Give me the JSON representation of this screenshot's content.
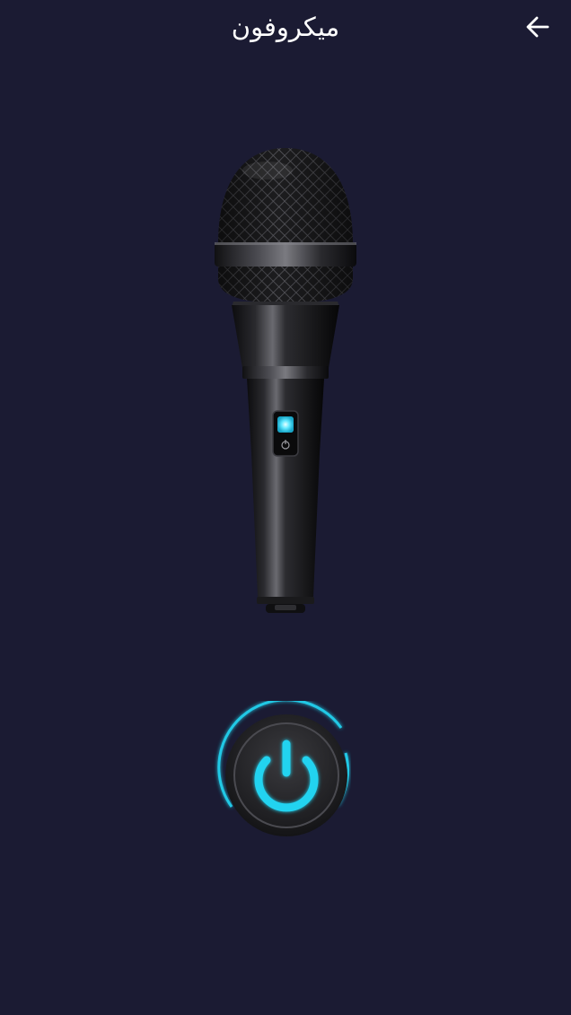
{
  "app": {
    "title": "میکروفون"
  },
  "icons": {
    "back": "arrow-left-icon",
    "microphone": "microphone-illustration",
    "power": "power-icon"
  },
  "colors": {
    "background": "#1b1b33",
    "accent": "#22d3f0",
    "text": "#ffffff"
  }
}
